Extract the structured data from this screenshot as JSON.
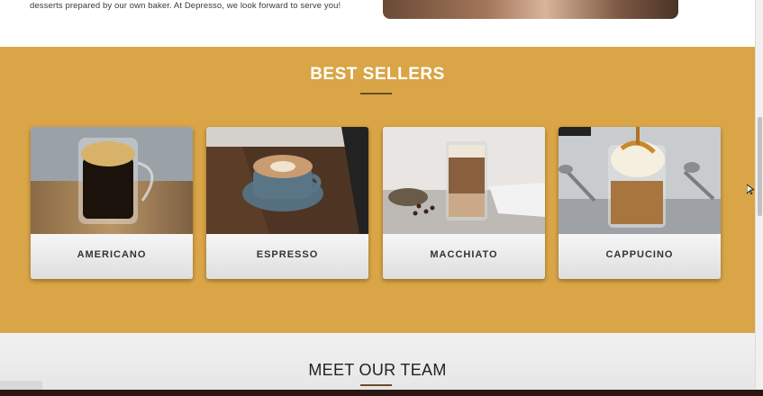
{
  "intro": {
    "text": "desserts prepared by our own baker. At Depresso, we look forward to serve you!"
  },
  "best_sellers": {
    "title": "BEST SELLERS",
    "items": [
      {
        "label": "AMERICANO"
      },
      {
        "label": "ESPRESSO"
      },
      {
        "label": "MACCHIATO"
      },
      {
        "label": "CAPPUCINO"
      }
    ]
  },
  "team": {
    "title": "MEET OUR TEAM"
  },
  "colors": {
    "band": "#d9a546",
    "accent": "#6b4d23",
    "card_bg": "#f1f1f1"
  }
}
